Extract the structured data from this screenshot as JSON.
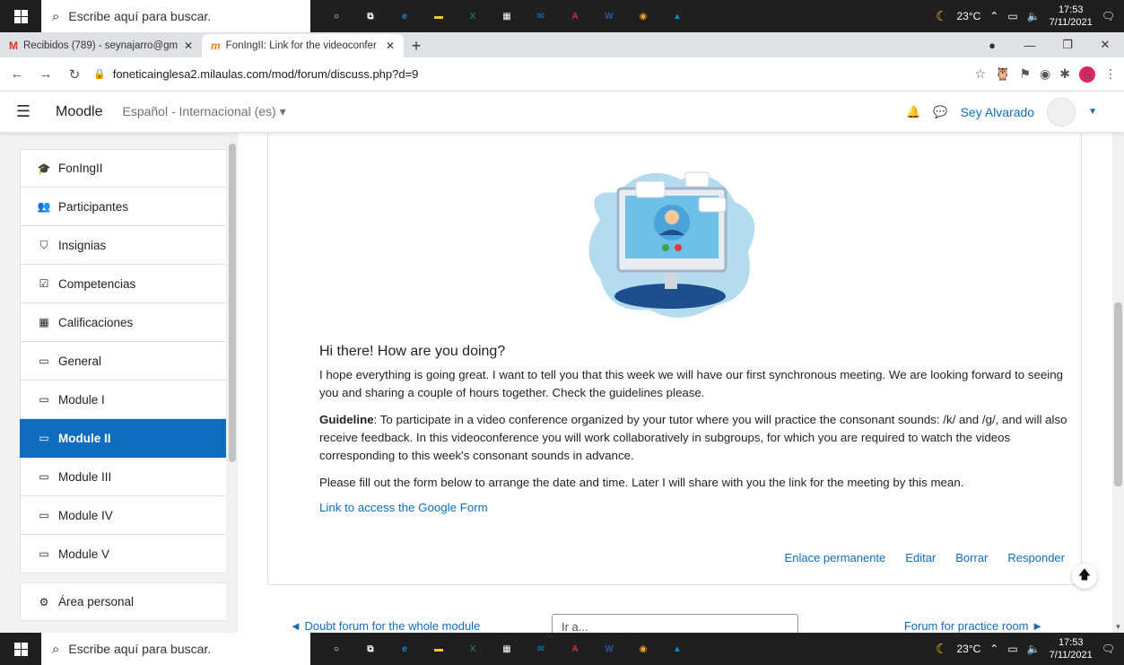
{
  "taskbar": {
    "search_placeholder": "Escribe aquí para buscar.",
    "weather": "23°C",
    "time": "17:53",
    "date": "7/11/2021",
    "apps": [
      {
        "name": "cortana-icon",
        "glyph": "○",
        "color": "#ffffff"
      },
      {
        "name": "task-view-icon",
        "glyph": "⧉",
        "color": "#ffffff"
      },
      {
        "name": "edge-icon",
        "glyph": "e",
        "color": "#1e88e5"
      },
      {
        "name": "file-explorer-icon",
        "glyph": "▬",
        "color": "#f4c430"
      },
      {
        "name": "excel-icon",
        "glyph": "X",
        "color": "#1e7145"
      },
      {
        "name": "store-icon",
        "glyph": "▦",
        "color": "#ffffff"
      },
      {
        "name": "mail-icon",
        "glyph": "✉",
        "color": "#0a84d6"
      },
      {
        "name": "acrobat-icon",
        "glyph": "A",
        "color": "#d32f2f"
      },
      {
        "name": "word-icon",
        "glyph": "W",
        "color": "#2b579a"
      },
      {
        "name": "chrome-icon",
        "glyph": "◉",
        "color": "#f9a825"
      },
      {
        "name": "photos-icon",
        "glyph": "▲",
        "color": "#0288d1"
      }
    ]
  },
  "browser": {
    "tabs": [
      {
        "title": "Recibidos (789) - seynajarro@gm"
      },
      {
        "title": "FonIngII: Link for the videoconfer"
      }
    ],
    "url": "foneticainglesa2.milaulas.com/mod/forum/discuss.php?d=9"
  },
  "moodle": {
    "brand": "Moodle",
    "language": "Español - Internacional (es) ▾",
    "user": "Sey Alvarado"
  },
  "drawer": {
    "items": [
      {
        "label": "FonIngII",
        "icon": "🎓"
      },
      {
        "label": "Participantes",
        "icon": "👥"
      },
      {
        "label": "Insignias",
        "icon": "⛉"
      },
      {
        "label": "Competencias",
        "icon": "☑"
      },
      {
        "label": "Calificaciones",
        "icon": "▦"
      },
      {
        "label": "General",
        "icon": "▭"
      },
      {
        "label": "Module I",
        "icon": "▭"
      },
      {
        "label": "Module II",
        "icon": "▭"
      },
      {
        "label": "Module III",
        "icon": "▭"
      },
      {
        "label": "Module IV",
        "icon": "▭"
      },
      {
        "label": "Module V",
        "icon": "▭"
      },
      {
        "label": "Área personal",
        "icon": "⚙"
      }
    ]
  },
  "post": {
    "greeting": "Hi there! How are you doing?",
    "para1": "I hope everything is going great. I want to tell you that this week we will have our first synchronous meeting. We are looking forward to seeing you and sharing a couple of hours together. Check the guidelines please.",
    "guideline_label": "Guideline",
    "guideline_text": ": To participate in a video conference organized by your tutor where you will practice the consonant sounds: /k/ and /g/, and will also receive feedback. In this videoconference you will work collaboratively in subgroups, for which you are required to watch the videos corresponding to this week's consonant sounds in advance.",
    "para3": "Please fill out the form below to arrange the date and time. Later I will share with you the link for the meeting by this mean.",
    "link": "Link to access the Google Form",
    "actions": [
      "Enlace permanente",
      "Editar",
      "Borrar",
      "Responder"
    ]
  },
  "pager": {
    "prev": "◄ Doubt forum for the whole module",
    "select": "Ir a...",
    "next": "Forum for practice room ►"
  }
}
